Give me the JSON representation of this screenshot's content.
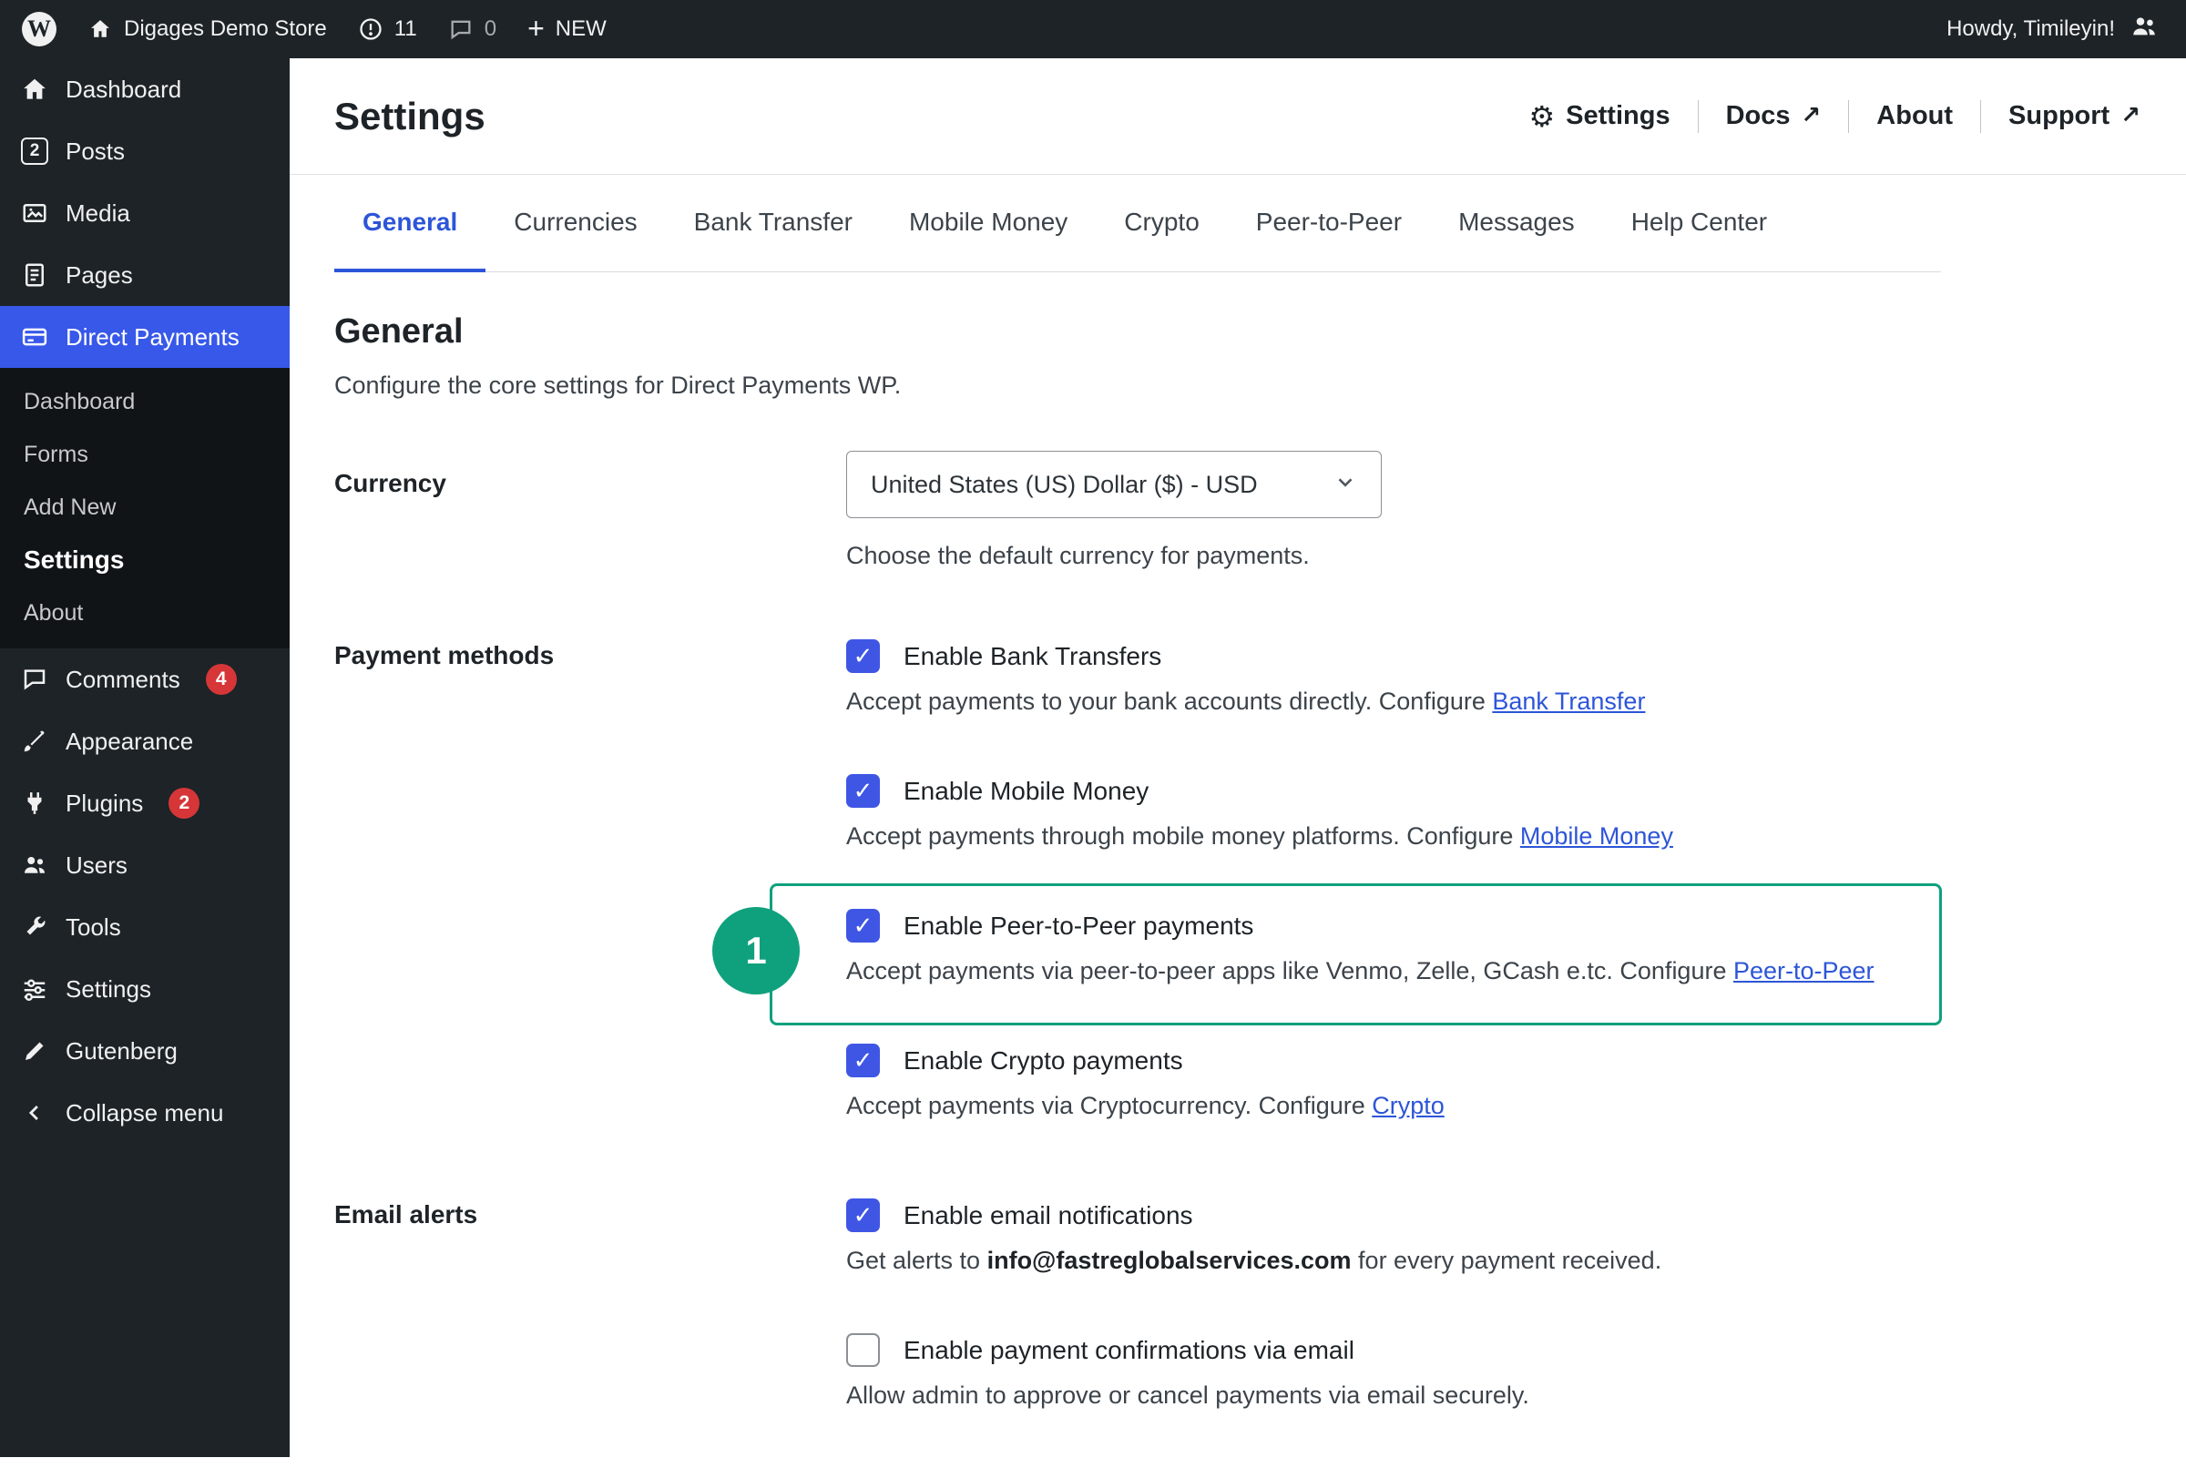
{
  "colors": {
    "accent_checkbox_blue": "#3f56e4",
    "sidebar_active_blue": "#3858e9",
    "link_blue": "#2d55d8",
    "highlight_green": "#0fa17d",
    "badge_red": "#d63638",
    "chrome_dark": "#1d2327"
  },
  "icons": {
    "check": "✓",
    "external": "↗",
    "gear": "⚙",
    "plus": "+"
  },
  "admin_bar": {
    "site_name": "Digages Demo Store",
    "alert_count": "11",
    "comment_count": "0",
    "new_label": "NEW",
    "greeting": "Howdy, Timileyin!"
  },
  "sidebar": {
    "posts_icon_text": "2",
    "items": [
      {
        "label": "Dashboard",
        "icon": "home-icon"
      },
      {
        "label": "Posts",
        "icon": "posts-icon"
      },
      {
        "label": "Media",
        "icon": "media-icon"
      },
      {
        "label": "Pages",
        "icon": "pages-icon"
      },
      {
        "label": "Direct Payments",
        "icon": "payments-icon",
        "active": true
      },
      {
        "label": "Comments",
        "icon": "comments-icon",
        "badge": "4"
      },
      {
        "label": "Appearance",
        "icon": "appearance-icon"
      },
      {
        "label": "Plugins",
        "icon": "plugins-icon",
        "badge": "2"
      },
      {
        "label": "Users",
        "icon": "users-icon"
      },
      {
        "label": "Tools",
        "icon": "tools-icon"
      },
      {
        "label": "Settings",
        "icon": "settings-icon"
      },
      {
        "label": "Gutenberg",
        "icon": "gutenberg-icon"
      },
      {
        "label": "Collapse menu",
        "icon": "collapse-icon"
      }
    ],
    "submenu": {
      "items": [
        "Dashboard",
        "Forms",
        "Add New",
        "Settings",
        "About"
      ],
      "current": "Settings"
    }
  },
  "header": {
    "title": "Settings",
    "actions": [
      {
        "label": "Settings",
        "icon": "gear-icon"
      },
      {
        "label": "Docs",
        "icon": "external-link-icon"
      },
      {
        "label": "About"
      },
      {
        "label": "Support",
        "icon": "external-link-icon"
      }
    ]
  },
  "tabs": {
    "items": [
      "General",
      "Currencies",
      "Bank Transfer",
      "Mobile Money",
      "Crypto",
      "Peer-to-Peer",
      "Messages",
      "Help Center"
    ],
    "active": "General"
  },
  "general": {
    "heading": "General",
    "description": "Configure the core settings for Direct Payments WP.",
    "currency": {
      "label": "Currency",
      "value": "United States (US) Dollar ($) - USD",
      "help": "Choose the default currency for payments."
    },
    "payment_methods": {
      "label": "Payment methods",
      "options": [
        {
          "label": "Enable Bank Transfers",
          "checked": true,
          "description": "Accept payments to your bank accounts directly. Configure ",
          "link": "Bank Transfer"
        },
        {
          "label": "Enable Mobile Money",
          "checked": true,
          "description": "Accept payments through mobile money platforms. Configure ",
          "link": "Mobile Money"
        },
        {
          "label": "Enable Peer-to-Peer payments",
          "checked": true,
          "description": "Accept payments via peer-to-peer apps like Venmo, Zelle, GCash e.tc. Configure ",
          "link": "Peer-to-Peer",
          "highlighted": true,
          "annotation": "1"
        },
        {
          "label": "Enable Crypto payments",
          "checked": true,
          "description": "Accept payments via Cryptocurrency. Configure ",
          "link": "Crypto"
        }
      ]
    },
    "email_alerts": {
      "label": "Email alerts",
      "options": [
        {
          "label": "Enable email notifications",
          "checked": true,
          "description_before": "Get alerts to ",
          "email": "info@fastreglobalservices.com",
          "description_after": " for every payment received."
        },
        {
          "label": "Enable payment confirmations via email",
          "checked": false,
          "description": "Allow admin to approve or cancel payments via email securely."
        }
      ]
    }
  }
}
